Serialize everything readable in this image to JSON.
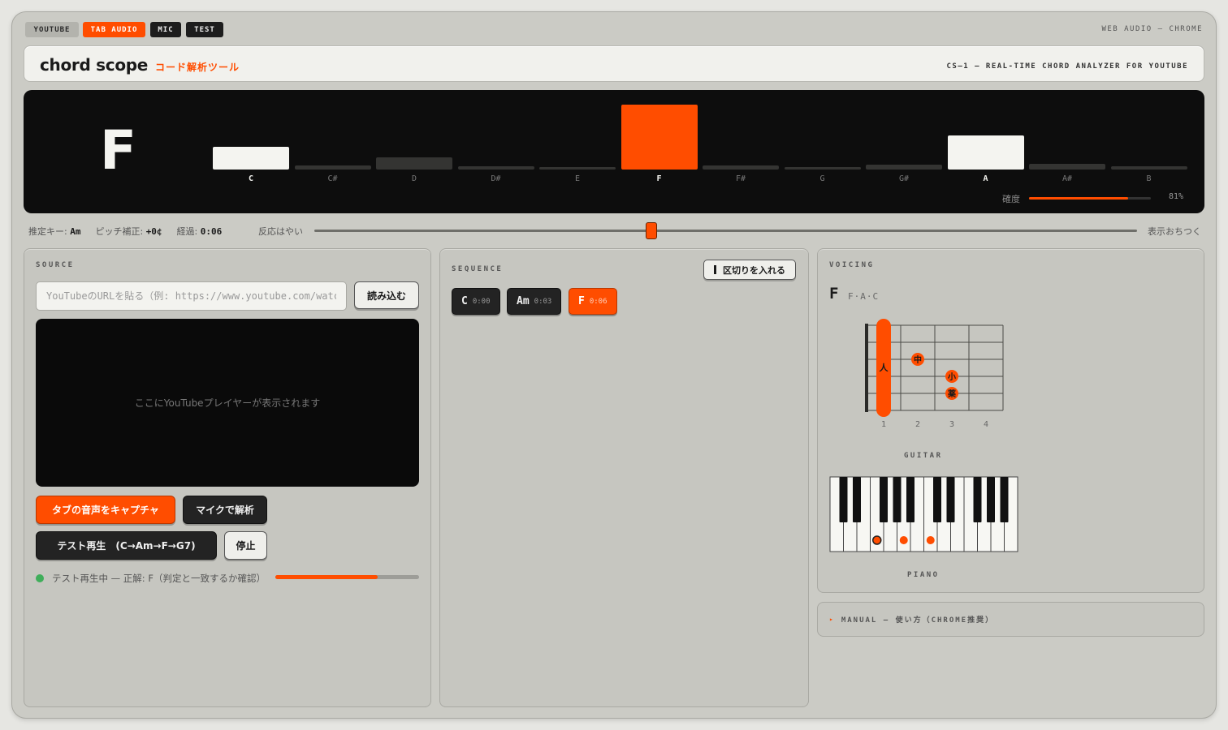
{
  "tabs": [
    {
      "label": "YOUTUBE",
      "state": "light"
    },
    {
      "label": "TAB AUDIO",
      "state": "active"
    },
    {
      "label": "MIC",
      "state": "dark"
    },
    {
      "label": "TEST",
      "state": "dark"
    }
  ],
  "env_label": "WEB AUDIO — CHROME",
  "header": {
    "title": "chord scope",
    "subtitle": "コード解析ツール",
    "tagline": "CS—1 — REAL-TIME CHORD ANALYZER FOR YOUTUBE"
  },
  "display": {
    "current_chord": "F",
    "confidence_label": "確度",
    "confidence": 0.81,
    "confidence_text": "81%"
  },
  "chroma": {
    "notes": [
      "C",
      "C#",
      "D",
      "D#",
      "E",
      "F",
      "F#",
      "G",
      "G#",
      "A",
      "A#",
      "B"
    ],
    "levels": [
      0.35,
      0.06,
      0.19,
      0.05,
      0.03,
      1.0,
      0.06,
      0.02,
      0.07,
      0.52,
      0.09,
      0.05
    ],
    "active": [
      "C",
      "F",
      "A"
    ]
  },
  "status": {
    "key_label": "推定キー:",
    "key_value": "Am",
    "pitch_label": "ピッチ補正:",
    "pitch_value": "+0¢",
    "elapsed_label": "経過:",
    "elapsed_value": "0:06",
    "slider_left": "反応はやい",
    "slider_right": "表示おちつく",
    "slider_value": 0.41
  },
  "source": {
    "title": "SOURCE",
    "url_placeholder": "YouTubeのURLを貼る（例: https://www.youtube.com/watch?v=...）",
    "load_label": "読み込む",
    "player_placeholder": "ここにYouTubeプレイヤーが表示されます",
    "capture_label": "タブの音声をキャプチャ",
    "mic_label": "マイクで解析",
    "test_play_label": "テスト再生　(C→Am→F→G7)",
    "stop_label": "停止",
    "test_status": "テスト再生中 — 正解: F（判定と一致するか確認）",
    "test_progress": 0.71
  },
  "sequence": {
    "title": "SEQUENCE",
    "mark_label": "区切りを入れる",
    "chords": [
      {
        "name": "C",
        "time": "0:00",
        "active": false
      },
      {
        "name": "Am",
        "time": "0:03",
        "active": false
      },
      {
        "name": "F",
        "time": "0:06",
        "active": true
      }
    ]
  },
  "voicing": {
    "title": "VOICING",
    "chord": "F",
    "notes": "F·A·C",
    "guitar_caption": "GUITAR",
    "piano_caption": "PIANO",
    "fret_numbers": [
      "1",
      "2",
      "3",
      "4"
    ],
    "finger_barre": "人",
    "finger_middle": "中",
    "finger_ring": "小",
    "finger_pinky": "薬"
  },
  "manual_label": "MANUAL — 使い方（CHROME推奨）",
  "colors": {
    "accent": "#ff4d00",
    "ok": "#3fae5a",
    "panel": "#c6c6c0",
    "display": "#0d0d0d"
  }
}
